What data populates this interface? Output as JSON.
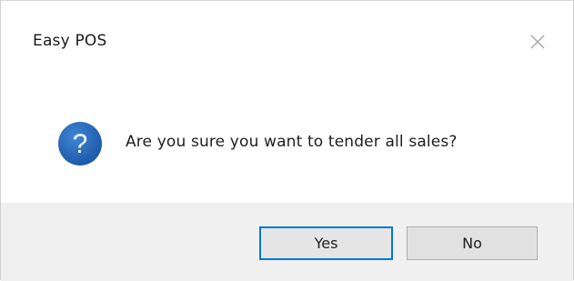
{
  "window": {
    "title": "Easy POS",
    "close_icon": "close-icon"
  },
  "message": {
    "icon": "question-icon",
    "icon_color": "#1f5fa8",
    "text": "Are you sure you want to tender all sales?"
  },
  "buttons": {
    "yes_label": "Yes",
    "no_label": "No",
    "default_button": "Yes",
    "accent_color": "#0078d7"
  }
}
